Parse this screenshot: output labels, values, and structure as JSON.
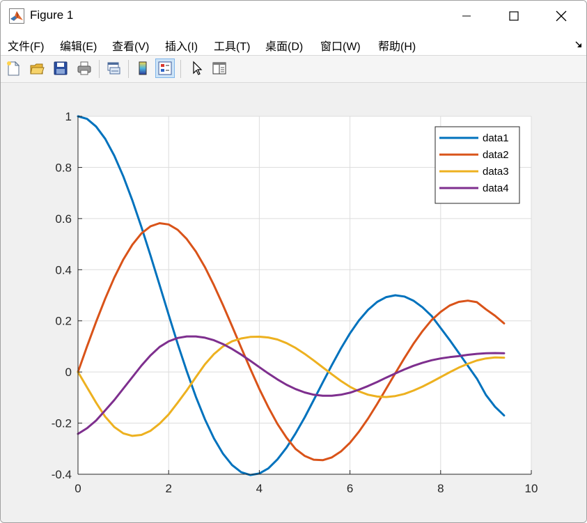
{
  "window": {
    "title": "Figure 1"
  },
  "menu": {
    "items": [
      "文件(F)",
      "编辑(E)",
      "查看(V)",
      "插入(I)",
      "工具(T)",
      "桌面(D)",
      "窗口(W)",
      "帮助(H)"
    ]
  },
  "toolbar": {
    "buttons": [
      "new-figure-icon",
      "open-file-icon",
      "save-icon",
      "print-icon",
      "link-plot-icon",
      "colorbar-icon",
      "legend-icon",
      "pointer-icon",
      "property-editor-icon"
    ],
    "active": "legend-icon"
  },
  "colors": {
    "data1": "#0072BD",
    "data2": "#D95319",
    "data3": "#EDB120",
    "data4": "#7E2F8E"
  },
  "chart_data": {
    "type": "line",
    "title": "",
    "xlabel": "",
    "ylabel": "",
    "xlim": [
      0,
      10
    ],
    "ylim": [
      -0.4,
      1
    ],
    "xticks": [
      0,
      2,
      4,
      6,
      8,
      10
    ],
    "yticks": [
      -0.4,
      -0.2,
      0,
      0.2,
      0.4,
      0.6,
      0.8,
      1
    ],
    "xtick_labels": [
      "0",
      "2",
      "4",
      "6",
      "8",
      "10"
    ],
    "ytick_labels": [
      "-0.4",
      "-0.2",
      "0",
      "0.2",
      "0.4",
      "0.6",
      "0.8",
      "1"
    ],
    "grid": true,
    "legend_position": "top-right",
    "x": [
      0,
      0.2,
      0.4,
      0.6,
      0.8,
      1.0,
      1.2,
      1.4,
      1.6,
      1.8,
      2.0,
      2.2,
      2.4,
      2.6,
      2.8,
      3.0,
      3.2,
      3.4,
      3.6,
      3.8,
      4.0,
      4.2,
      4.4,
      4.6,
      4.8,
      5.0,
      5.2,
      5.4,
      5.6,
      5.8,
      6.0,
      6.2,
      6.4,
      6.6,
      6.8,
      7.0,
      7.2,
      7.4,
      7.6,
      7.8,
      8.0,
      8.2,
      8.4,
      8.6,
      8.8,
      9.0,
      9.2,
      9.4
    ],
    "series": [
      {
        "name": "data1",
        "color": "#0072BD",
        "values": [
          1.0,
          0.99,
          0.96,
          0.912,
          0.846,
          0.765,
          0.671,
          0.567,
          0.455,
          0.34,
          0.224,
          0.11,
          0.003,
          -0.097,
          -0.185,
          -0.26,
          -0.32,
          -0.364,
          -0.392,
          -0.403,
          -0.397,
          -0.377,
          -0.342,
          -0.296,
          -0.24,
          -0.178,
          -0.11,
          -0.041,
          0.027,
          0.092,
          0.151,
          0.202,
          0.243,
          0.274,
          0.293,
          0.3,
          0.295,
          0.279,
          0.253,
          0.219,
          0.172,
          0.125,
          0.075,
          0.024,
          -0.026,
          -0.09,
          -0.136,
          -0.17
        ]
      },
      {
        "name": "data2",
        "color": "#D95319",
        "values": [
          0.0,
          0.1,
          0.196,
          0.287,
          0.369,
          0.44,
          0.498,
          0.542,
          0.57,
          0.582,
          0.577,
          0.556,
          0.52,
          0.471,
          0.41,
          0.339,
          0.261,
          0.179,
          0.095,
          0.013,
          -0.066,
          -0.138,
          -0.203,
          -0.257,
          -0.301,
          -0.328,
          -0.343,
          -0.345,
          -0.334,
          -0.311,
          -0.277,
          -0.233,
          -0.182,
          -0.125,
          -0.065,
          -0.005,
          0.054,
          0.11,
          0.16,
          0.203,
          0.235,
          0.26,
          0.274,
          0.279,
          0.273,
          0.245,
          0.22,
          0.19
        ]
      },
      {
        "name": "data3",
        "color": "#EDB120",
        "values": [
          0.0,
          -0.06,
          -0.12,
          -0.175,
          -0.215,
          -0.24,
          -0.25,
          -0.246,
          -0.23,
          -0.202,
          -0.166,
          -0.12,
          -0.072,
          -0.02,
          0.03,
          0.07,
          0.1,
          0.12,
          0.131,
          0.137,
          0.138,
          0.135,
          0.127,
          0.113,
          0.094,
          0.071,
          0.045,
          0.018,
          -0.009,
          -0.035,
          -0.058,
          -0.076,
          -0.089,
          -0.096,
          -0.098,
          -0.094,
          -0.086,
          -0.073,
          -0.057,
          -0.039,
          -0.02,
          -0.001,
          0.017,
          0.032,
          0.045,
          0.053,
          0.057,
          0.056
        ]
      },
      {
        "name": "data4",
        "color": "#7E2F8E",
        "values": [
          -0.242,
          -0.22,
          -0.19,
          -0.15,
          -0.11,
          -0.065,
          -0.02,
          0.025,
          0.065,
          0.098,
          0.12,
          0.133,
          0.139,
          0.139,
          0.134,
          0.124,
          0.109,
          0.09,
          0.068,
          0.044,
          0.019,
          -0.006,
          -0.029,
          -0.05,
          -0.067,
          -0.08,
          -0.089,
          -0.093,
          -0.093,
          -0.089,
          -0.081,
          -0.069,
          -0.055,
          -0.039,
          -0.022,
          -0.006,
          0.01,
          0.024,
          0.036,
          0.046,
          0.053,
          0.058,
          0.062,
          0.067,
          0.071,
          0.073,
          0.074,
          0.073
        ]
      }
    ]
  }
}
